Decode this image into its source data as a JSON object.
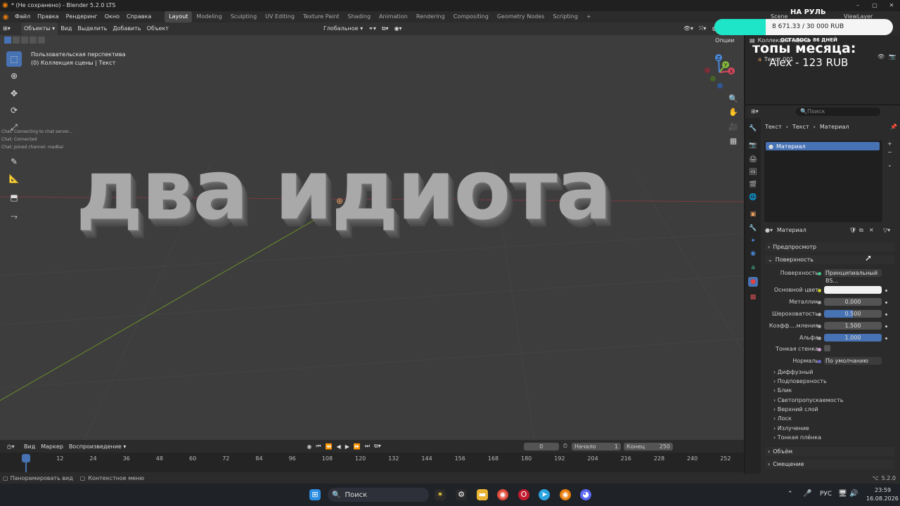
{
  "window": {
    "title": "* (Не сохранено) - Blender 5.2.0 LTS"
  },
  "menu": {
    "items": [
      "Файл",
      "Правка",
      "Рендеринг",
      "Окно",
      "Справка"
    ],
    "workspaces": [
      "Layout",
      "Modeling",
      "Sculpting",
      "UV Editing",
      "Texture Paint",
      "Shading",
      "Animation",
      "Rendering",
      "Compositing",
      "Geometry Nodes",
      "Scripting"
    ],
    "add_tab": "+",
    "scene": "Scene",
    "view_layer": "ViewLayer"
  },
  "viewport": {
    "mode": "Объекты",
    "menus": [
      "Вид",
      "Выделить",
      "Добавить",
      "Объект"
    ],
    "orientation": "Глобальное",
    "options": "Опции",
    "info_line1": "Пользовательская перспектива",
    "info_line2": "(0) Коллекция сцены | Текст",
    "chat_lines": [
      "Chat: Connecting to chat server...",
      "Chat: Connected",
      "Chat: Joined channel: madkai"
    ],
    "text_3d": "два идиота",
    "gizmo_axes": {
      "x": "X",
      "y": "Y",
      "z": "Z"
    }
  },
  "outliner": {
    "row1": "Коллекция сцены",
    "row2": "Текст.001",
    "search_placeholder": "Поиск"
  },
  "overlay": {
    "title": "НА РУЛЬ",
    "amount": "8 671.33 / 30 000 RUB",
    "progress_fraction": 0.289,
    "days_left": "ОСТАЛОСЬ 86 ДНЕЙ",
    "top_title": "топы месяца:",
    "top_entry": "Alex - 123 RUB"
  },
  "properties": {
    "breadcrumb": [
      "Текст",
      "Текст",
      "Материал"
    ],
    "slot_name": "Материал",
    "material_name": "Материал",
    "panels": {
      "preview": "Предпросмотр",
      "surface": "Поверхность",
      "volume": "Объём",
      "displacement": "Смещение"
    },
    "fields": [
      {
        "label": "Поверхность",
        "value": "Принципиальный BS..."
      },
      {
        "label": "Основной цвет",
        "value": ""
      },
      {
        "label": "Металлик",
        "value": "0.000"
      },
      {
        "label": "Шероховатость",
        "value": "0.500"
      },
      {
        "label": "Коэфф....мления",
        "value": "1.500"
      },
      {
        "label": "Альфа",
        "value": "1.000"
      },
      {
        "label": "Тонкая стенка",
        "value": ""
      },
      {
        "label": "Нормаль",
        "value": "По умолчанию"
      }
    ],
    "roughness_fraction": 0.5,
    "alpha_fraction": 1.0,
    "subpanels": [
      "Диффузный",
      "Подповерхность",
      "Блик",
      "Светопропускаемость",
      "Верхний слой",
      "Лоск",
      "Излучение",
      "Тонкая плёнка"
    ]
  },
  "timeline": {
    "menus": [
      "Вид",
      "Маркер",
      "Воспроизведение"
    ],
    "current_frame": "0",
    "start_label": "Начало",
    "start": "1",
    "end_label": "Конец",
    "end": "250",
    "ticks": [
      "0",
      "12",
      "24",
      "36",
      "48",
      "60",
      "72",
      "84",
      "96",
      "108",
      "120",
      "132",
      "144",
      "156",
      "168",
      "180",
      "192",
      "204",
      "216",
      "228",
      "240",
      "252"
    ]
  },
  "statusbar": {
    "left1": "Панорамировать вид",
    "left2": "Контекстное меню",
    "version": "5.2.0"
  },
  "taskbar": {
    "search": "Поиск",
    "lang": "РУС",
    "time": "23:59",
    "date": "16.08.2026"
  },
  "colors": {
    "accent": "#4772b3",
    "overlay_fill": "#1ee5c8",
    "axis_x": "#d6485f",
    "axis_y": "#84b83b",
    "axis_z": "#4a87d8"
  }
}
